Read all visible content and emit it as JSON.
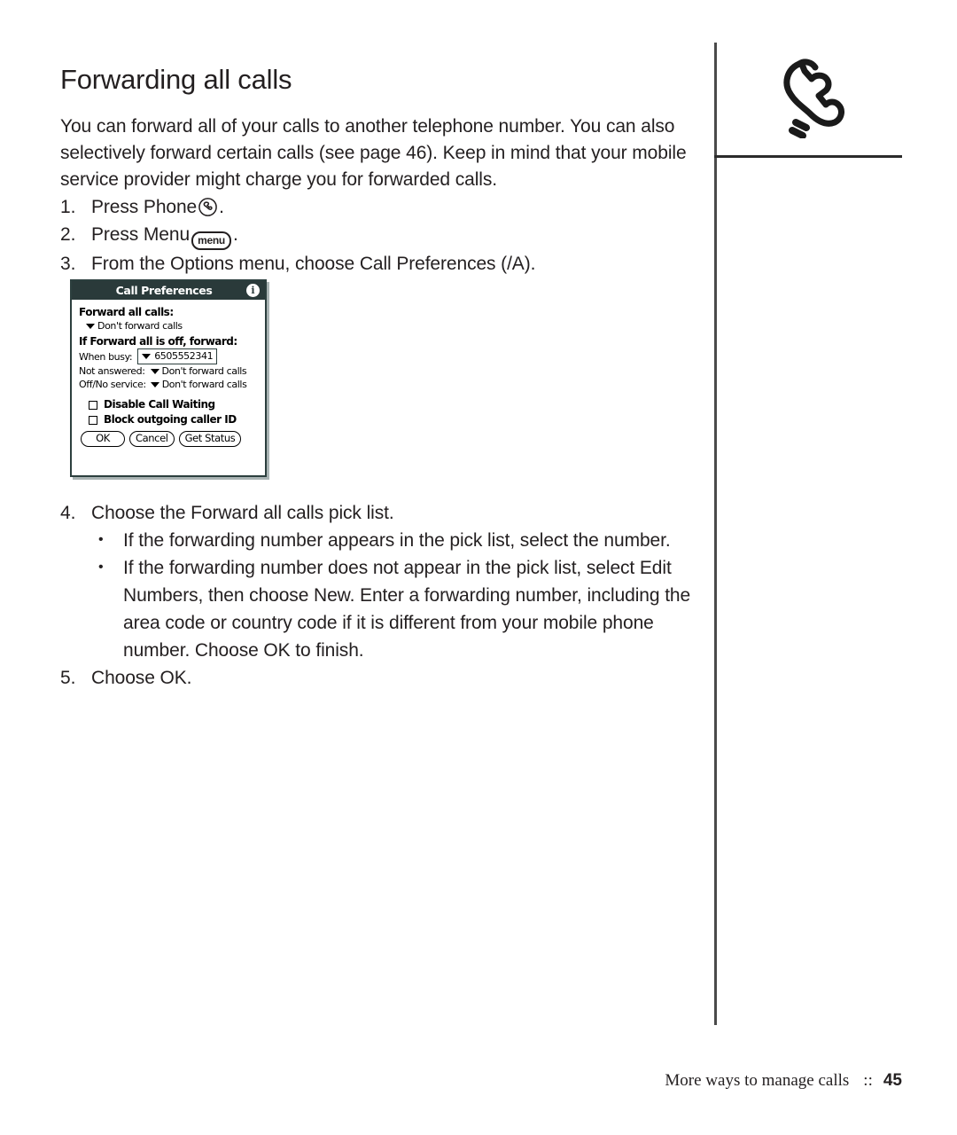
{
  "page": {
    "heading": "Forwarding all calls",
    "intro": "You can forward all of your calls to another telephone number. You can also selectively forward certain calls (see page 46). Keep in mind that your mobile service provider might charge you for forwarded calls.",
    "margin_icon": "phone-handset-icon"
  },
  "steps": [
    {
      "num": "1.",
      "pre": "Press Phone",
      "icon": "phone-circle-icon",
      "post": "."
    },
    {
      "num": "2.",
      "pre": "Press Menu",
      "icon": "menu-button-icon",
      "icon_label": "menu",
      "post": "."
    },
    {
      "num": "3.",
      "pre": "From the Options menu, choose Call Preferences (/A).",
      "icon": "",
      "post": ""
    },
    {
      "num": "4.",
      "pre": "Choose the Forward all calls pick list.",
      "icon": "",
      "post": ""
    },
    {
      "num": "5.",
      "pre": "Choose OK.",
      "icon": "",
      "post": ""
    }
  ],
  "substeps": [
    {
      "bullet": "•",
      "text": "If the forwarding number appears in the pick list, select the number."
    },
    {
      "bullet": "•",
      "text": "If the forwarding number does not appear in the pick list, select Edit Numbers, then choose New. Enter a forwarding number, including the area code or country code if it is different from your mobile phone number. Choose OK to finish."
    }
  ],
  "device_dialog": {
    "title": "Call Preferences",
    "info_icon_glyph": "i",
    "section_1_label": "Forward all calls:",
    "forward_all_value": "Don't forward calls",
    "section_2_label": "If Forward all is off, forward:",
    "rows": [
      {
        "label": "When busy:",
        "value": "6505552341",
        "selected": true
      },
      {
        "label": "Not answered:",
        "value": "Don't forward calls",
        "selected": false
      },
      {
        "label": "Off/No service:",
        "value": "Don't forward calls",
        "selected": false
      }
    ],
    "checkboxes": [
      {
        "label": "Disable Call Waiting",
        "checked": false
      },
      {
        "label": "Block outgoing caller ID",
        "checked": false
      }
    ],
    "buttons": [
      {
        "label": "OK"
      },
      {
        "label": "Cancel"
      },
      {
        "label": "Get Status"
      }
    ]
  },
  "footer": {
    "section": "More ways to manage calls",
    "separator": "::",
    "page_number": "45"
  },
  "colors": {
    "text": "#231f20",
    "rule": "#4a4a4a",
    "device_titlebar": "#2a3a3a",
    "device_border": "#2c3f3e"
  }
}
